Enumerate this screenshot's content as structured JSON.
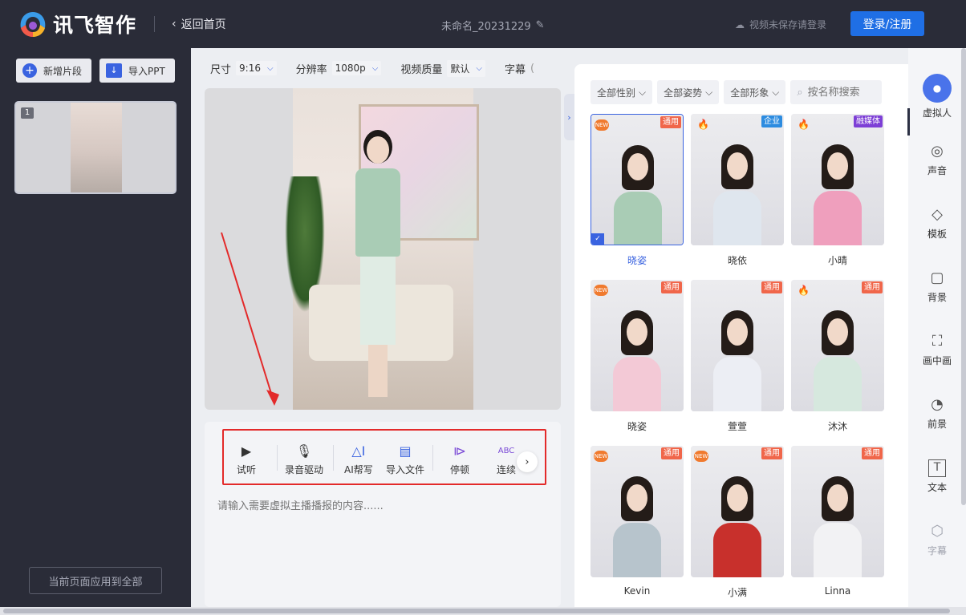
{
  "header": {
    "logo_text": "讯飞智作",
    "back_label": "返回首页",
    "doc_title": "未命名_20231229",
    "save_hint": "视频未保存请登录",
    "login_label": "登录/注册"
  },
  "left": {
    "add_segment": "新增片段",
    "import_ppt": "导入PPT",
    "slide_number": "1",
    "apply_all": "当前页面应用到全部"
  },
  "settings": {
    "size_label": "尺寸",
    "size_value": "9:16",
    "res_label": "分辨率",
    "res_value": "1080p",
    "quality_label": "视频质量",
    "quality_value": "默认",
    "subtitle_label": "字幕"
  },
  "tools": {
    "items": [
      "试听",
      "录音驱动",
      "AI帮写",
      "导入文件",
      "停顿",
      "连续"
    ]
  },
  "script": {
    "placeholder": "请输入需要虚拟主播播报的内容......"
  },
  "gallery": {
    "filters": [
      "全部性别",
      "全部姿势",
      "全部形象"
    ],
    "search_placeholder": "按名称搜索",
    "cards": [
      {
        "name": "晓姿",
        "badge": "通用",
        "badge_color": "#f0664a",
        "corner": "new",
        "selected": true,
        "outfit": "#a9ccb5"
      },
      {
        "name": "晓依",
        "badge": "企业",
        "badge_color": "#2d8ce0",
        "corner": "fire",
        "selected": false,
        "outfit": "#dfe6ee"
      },
      {
        "name": "小晴",
        "badge": "融媒体",
        "badge_color": "#7d3fd6",
        "corner": "fire",
        "selected": false,
        "outfit": "#ef9fbd"
      },
      {
        "name": "晓姿",
        "badge": "通用",
        "badge_color": "#f0664a",
        "corner": "new",
        "selected": false,
        "outfit": "#f3c9d6"
      },
      {
        "name": "萱萱",
        "badge": "通用",
        "badge_color": "#f0664a",
        "corner": "",
        "selected": false,
        "outfit": "#eceef4"
      },
      {
        "name": "沐沐",
        "badge": "通用",
        "badge_color": "#f0664a",
        "corner": "fire",
        "selected": false,
        "outfit": "#d6e8de"
      },
      {
        "name": "Kevin",
        "badge": "通用",
        "badge_color": "#f0664a",
        "corner": "new",
        "selected": false,
        "outfit": "#b7c4cc"
      },
      {
        "name": "小满",
        "badge": "通用",
        "badge_color": "#f0664a",
        "corner": "new",
        "selected": false,
        "outfit": "#c8302c"
      },
      {
        "name": "Linna",
        "badge": "通用",
        "badge_color": "#f0664a",
        "corner": "",
        "selected": false,
        "outfit": "#f2f2f4"
      }
    ]
  },
  "nav": {
    "items": [
      "虚拟人",
      "声音",
      "模板",
      "背景",
      "画中画",
      "前景",
      "文本",
      "字幕"
    ]
  },
  "colors": {
    "accent": "#1f6fe5",
    "highlight_box": "#e32a2a",
    "dark_bg": "#2a2c38"
  }
}
